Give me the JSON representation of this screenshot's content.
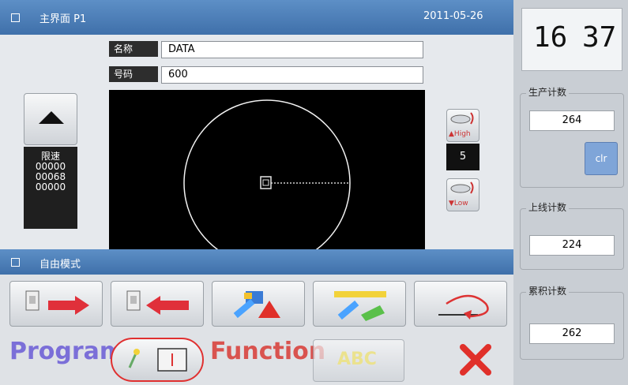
{
  "header": {
    "title": "主界面 P1",
    "date": "2011-05-26"
  },
  "pattern": {
    "name_label": "名称",
    "name_value": "DATA",
    "number_label": "号码",
    "number_value": "600"
  },
  "side_stats": [
    "限速",
    "00000",
    "00068",
    "00000"
  ],
  "speed": {
    "high_label": "High",
    "value": "5",
    "low_label": "Low"
  },
  "mode_bar": {
    "title": "自由模式"
  },
  "bottom_row": {
    "program_label": "Program",
    "function_label": "Function",
    "abc_label": "ABC"
  },
  "clock": {
    "hour": "16",
    "minute": "37"
  },
  "counters": {
    "production": {
      "label": "生产计数",
      "value": "264"
    },
    "bobbin": {
      "label": "上线计数",
      "value": "224"
    },
    "total": {
      "label": "累积计数",
      "value": "262"
    },
    "clear_button": "clr"
  },
  "colors": {
    "title_bar": "#3f70aa",
    "accent_purple": "#7b6fd8",
    "close_red": "#e0302a"
  }
}
